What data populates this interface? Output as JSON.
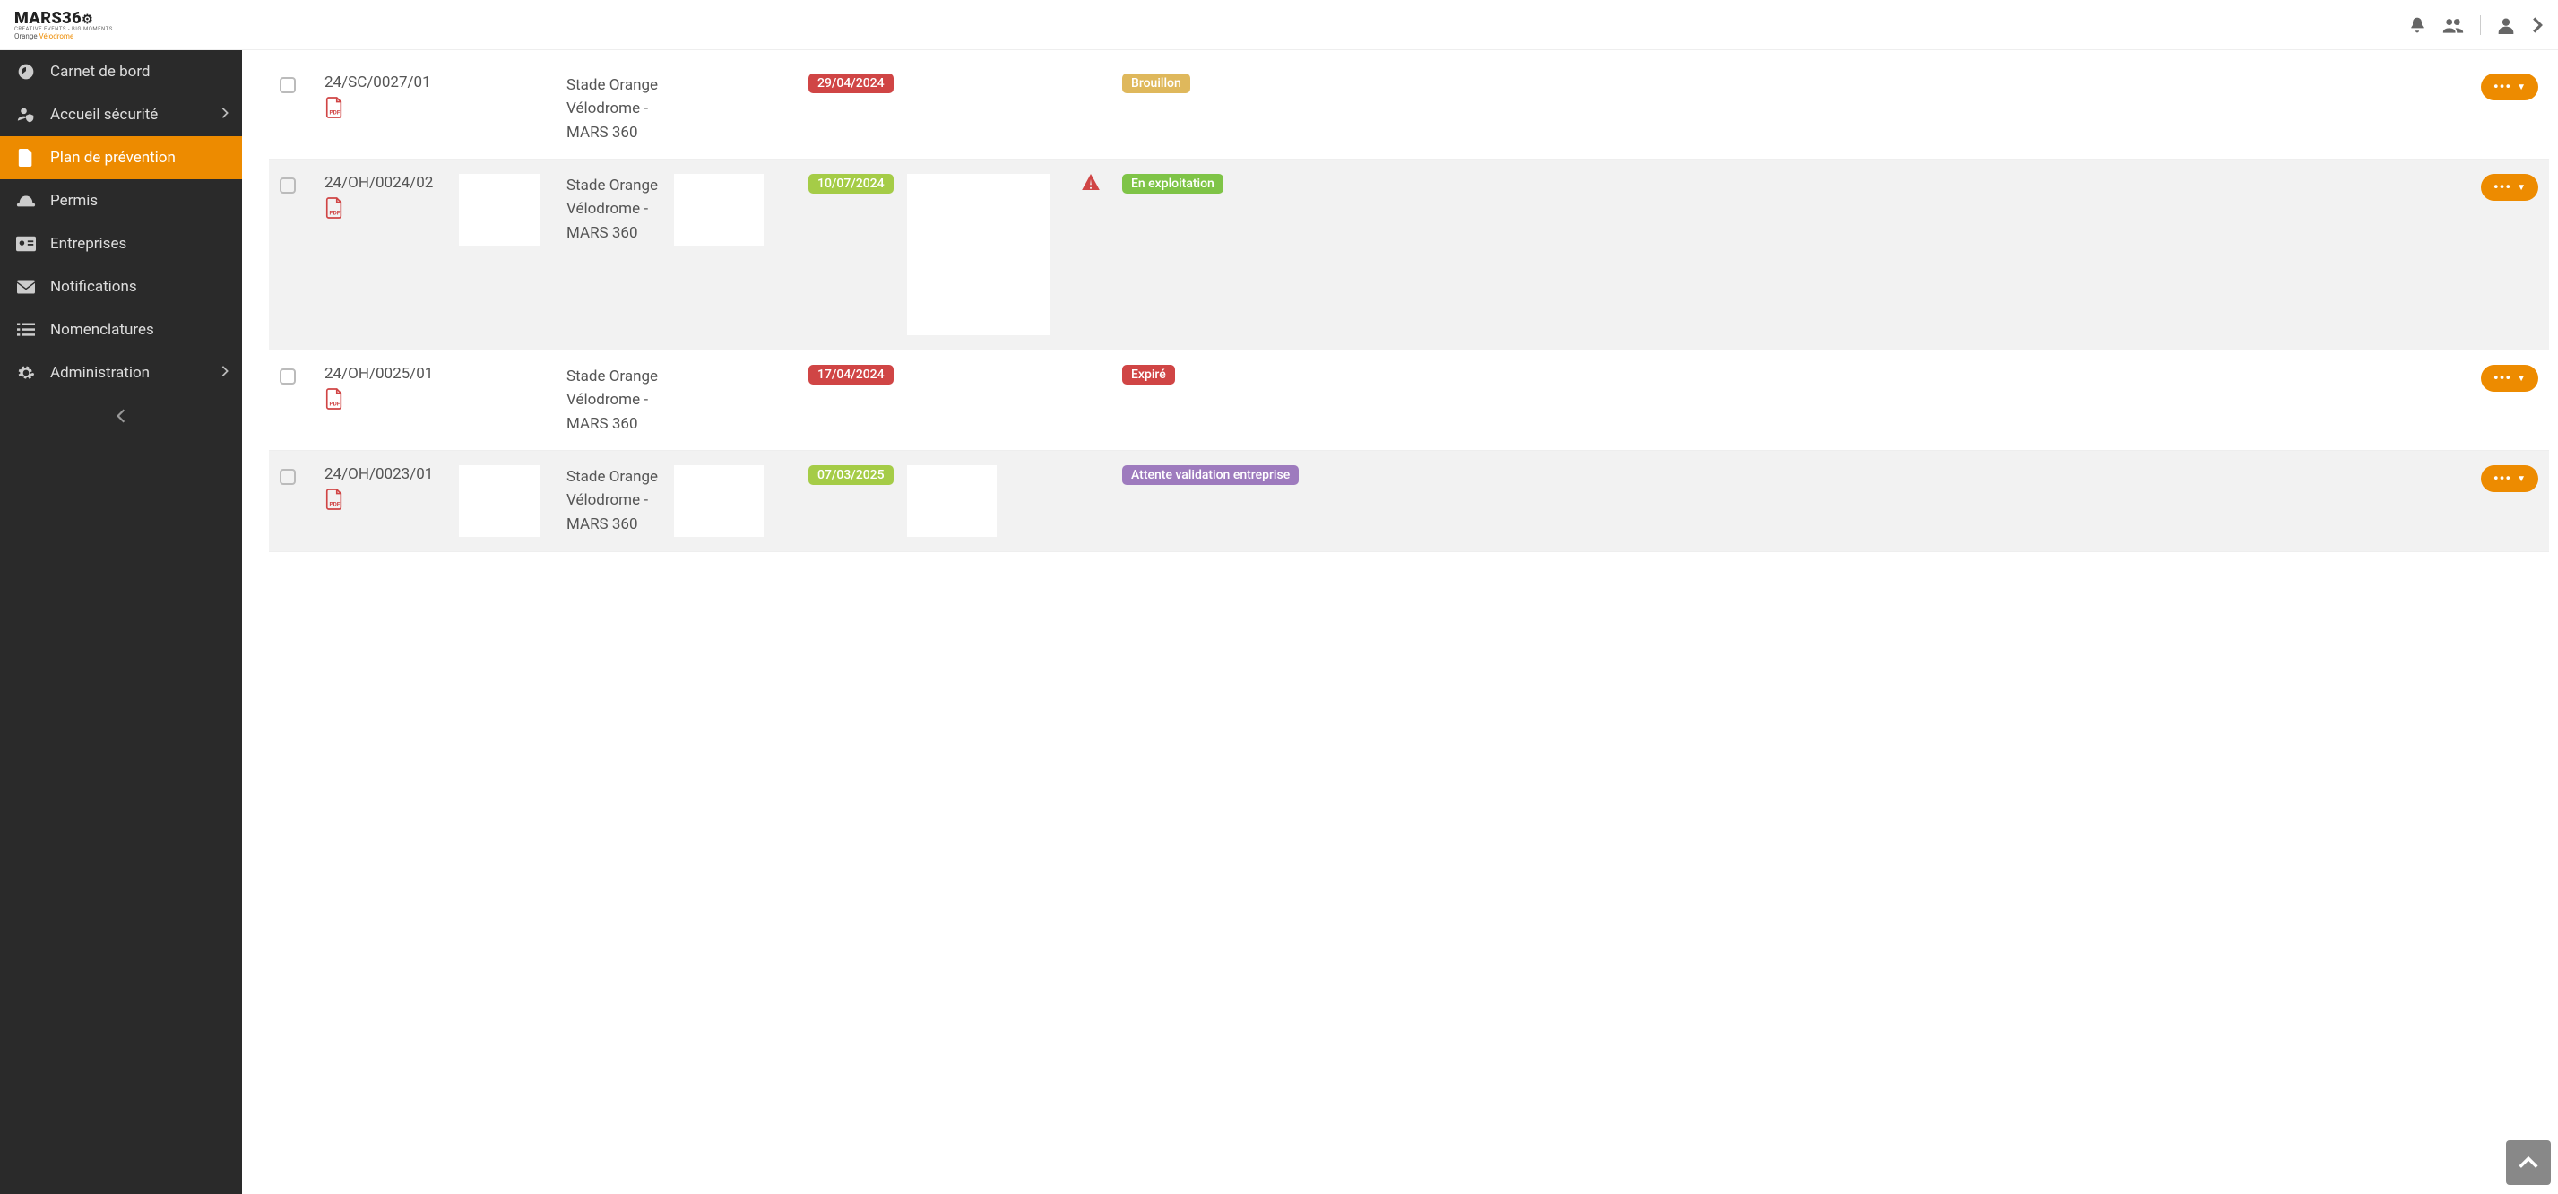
{
  "logo": {
    "main": "MARS36",
    "tagline": "CREATIVE EVENTS - BIG MOMENTS",
    "sub_prefix": "Orange ",
    "sub_accent": "Vélodrome"
  },
  "sidebar": {
    "items": [
      {
        "label": "Carnet de bord",
        "icon": "dashboard",
        "expandable": false,
        "active": false
      },
      {
        "label": "Accueil sécurité",
        "icon": "user-shield",
        "expandable": true,
        "active": false
      },
      {
        "label": "Plan de prévention",
        "icon": "file",
        "expandable": false,
        "active": true
      },
      {
        "label": "Permis",
        "icon": "hardhat",
        "expandable": false,
        "active": false
      },
      {
        "label": "Entreprises",
        "icon": "id-card",
        "expandable": false,
        "active": false
      },
      {
        "label": "Notifications",
        "icon": "envelope",
        "expandable": false,
        "active": false
      },
      {
        "label": "Nomenclatures",
        "icon": "list",
        "expandable": false,
        "active": false
      },
      {
        "label": "Administration",
        "icon": "cog",
        "expandable": true,
        "active": false
      }
    ]
  },
  "rows": [
    {
      "ref": "24/SC/0027/01",
      "location": "Stade Orange Vélodrome - MARS 360",
      "date": "29/04/2024",
      "date_color": "red",
      "status": "Brouillon",
      "status_class": "brouillon",
      "has_warning": false,
      "has_redacted": false
    },
    {
      "ref": "24/OH/0024/02",
      "location": "Stade Orange Vélodrome - MARS 360",
      "date": "10/07/2024",
      "date_color": "green",
      "status": "En exploitation",
      "status_class": "exploitation",
      "has_warning": true,
      "has_redacted": true
    },
    {
      "ref": "24/OH/0025/01",
      "location": "Stade Orange Vélodrome - MARS 360",
      "date": "17/04/2024",
      "date_color": "red",
      "status": "Expiré",
      "status_class": "expire",
      "has_warning": false,
      "has_redacted": false
    },
    {
      "ref": "24/OH/0023/01",
      "location": "Stade Orange Vélodrome - MARS 360",
      "date": "07/03/2025",
      "date_color": "green",
      "status": "Attente validation entreprise",
      "status_class": "attente",
      "has_warning": false,
      "has_redacted": true
    }
  ]
}
